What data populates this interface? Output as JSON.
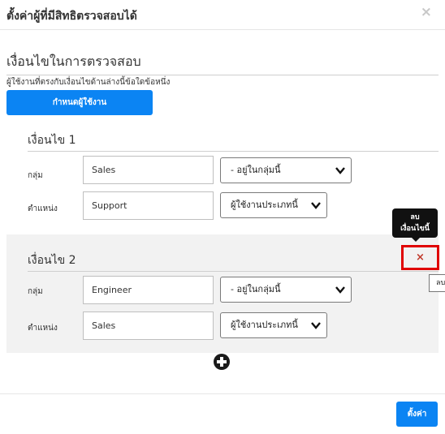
{
  "dialog": {
    "title": "ตั้งค่าผู้ที่มีสิทธิตรวจสอบได้",
    "close_symbol": "×"
  },
  "section": {
    "title": "เงื่อนไขในการตรวจสอบ",
    "description": "ผู้ใช้งานที่ตรงกับเงื่อนไขด้านล่างนี้ข้อใดข้อหนึ่ง",
    "assign_button": "กำหนดผู้ใช้งาน"
  },
  "conditions": [
    {
      "title": "เงื่อนไข 1",
      "group_label": "กลุ่ม",
      "group_value": "Sales",
      "group_operator": "- อยู่ในกลุ่มนี้",
      "position_label": "ตำแหน่ง",
      "position_value": "Support",
      "position_operator": "ผู้ใช้งานประเภทนี้"
    },
    {
      "title": "เงื่อนไข 2",
      "group_label": "กลุ่ม",
      "group_value": "Engineer",
      "group_operator": "- อยู่ในกลุ่มนี้",
      "position_label": "ตำแหน่ง",
      "position_value": "Sales",
      "position_operator": "ผู้ใช้งานประเภทนี้"
    }
  ],
  "delete_tooltip": {
    "line1": "ลบ",
    "line2": "เงื่อนไขนี้",
    "partial": "ลบ"
  },
  "delete_symbol": "×",
  "footer": {
    "save_button": "ตั้งค่า"
  },
  "colors": {
    "primary": "#0b84f3",
    "highlight": "#e00000",
    "delete": "#c0392b"
  },
  "icons": {
    "close": "close-icon",
    "add": "plus-circle-icon",
    "delete": "x-icon",
    "dropdown": "chevron-down-icon"
  }
}
